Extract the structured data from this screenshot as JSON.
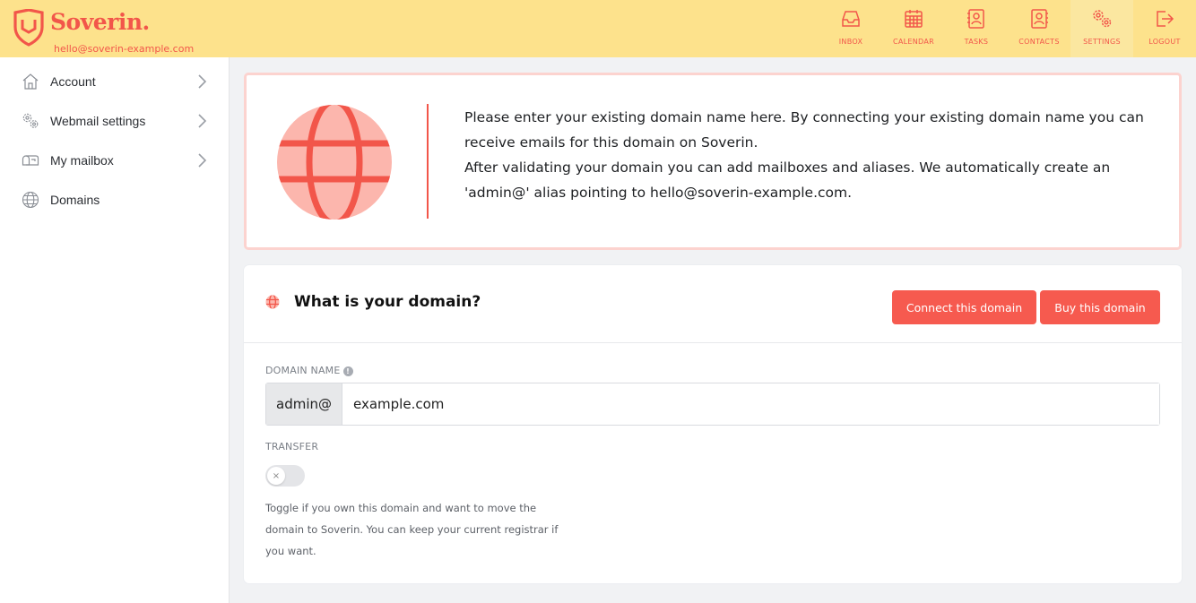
{
  "brand": {
    "name": "Soverin.",
    "email": "hello@soverin-example.com",
    "accent": "#f2564a",
    "header_bg": "#fde28c"
  },
  "nav": [
    {
      "label": "INBOX",
      "icon": "inbox-icon"
    },
    {
      "label": "CALENDAR",
      "icon": "calendar-icon"
    },
    {
      "label": "TASKS",
      "icon": "tasks-icon"
    },
    {
      "label": "CONTACTS",
      "icon": "contacts-icon"
    },
    {
      "label": "SETTINGS",
      "icon": "settings-icon",
      "active": true
    },
    {
      "label": "LOGOUT",
      "icon": "logout-icon"
    }
  ],
  "sidebar": {
    "items": [
      {
        "label": "Account",
        "icon": "home-icon"
      },
      {
        "label": "Webmail settings",
        "icon": "gears-icon"
      },
      {
        "label": "My mailbox",
        "icon": "mailbox-icon"
      },
      {
        "label": "Domains",
        "icon": "globe-icon"
      }
    ]
  },
  "info": {
    "paragraph1": "Please enter your existing domain name here. By connecting your existing domain name you can receive emails for this domain on Soverin.",
    "paragraph2": "After validating your domain you can add mailboxes and aliases. We automatically create an 'admin@' alias pointing to hello@soverin-example.com."
  },
  "domain_card": {
    "title": "What is your domain?",
    "connect_button": "Connect this domain",
    "buy_button": "Buy this domain",
    "domain_label": "DOMAIN NAME",
    "domain_prefix": "admin@",
    "domain_value": "example.com",
    "transfer_label": "TRANSFER",
    "toggle_knob": "×",
    "transfer_help": "Toggle if you own this domain and want to move the domain to Soverin. You can keep your current registrar if you want."
  }
}
